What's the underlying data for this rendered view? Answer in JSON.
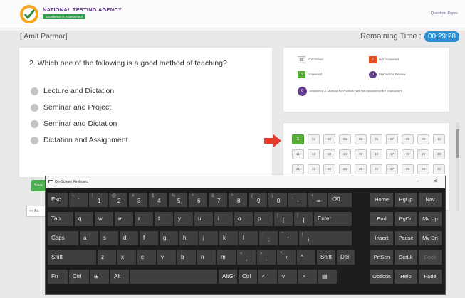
{
  "header": {
    "agency": "NATIONAL TESTING AGENCY",
    "tagline": "Excellence in Assessment",
    "question_paper_link": "Question Paper"
  },
  "exam": {
    "candidate": "[ Amit Parmar]",
    "remaining_label": "Remaining Time :",
    "timer": "00:29:28"
  },
  "question": {
    "text": "2. Which one of the following is a good method of teaching?",
    "options": [
      "Lecture and Dictation",
      "Seminar and Project",
      "Seminar and Dictation",
      "Dictation and Assignment."
    ]
  },
  "buttons": {
    "save_next": "Save",
    "prev": "<< Ba"
  },
  "legend": {
    "not_visited": {
      "count": "99",
      "label": "Not Visited"
    },
    "not_answered": {
      "count": "2",
      "label": "Not Answered"
    },
    "answered": {
      "count": "3",
      "label": "Answered"
    },
    "marked": {
      "count": "0",
      "label": "Marked for Review"
    },
    "answered_marked": {
      "count": "0",
      "label": "Answered & Marked for Review (will be considered for evaluation)"
    }
  },
  "palette": {
    "numbers": [
      "1",
      "02",
      "03",
      "04",
      "05",
      "06",
      "07",
      "08",
      "09",
      "10",
      "11",
      "12",
      "13",
      "14",
      "15",
      "16",
      "17",
      "18",
      "19",
      "20",
      "21",
      "22",
      "23",
      "24",
      "25",
      "26",
      "27",
      "28",
      "29",
      "30"
    ],
    "answered_index": 0
  },
  "keyboard": {
    "title": "On-Screen Keyboard",
    "minimize": "–",
    "close": "✕",
    "row1": [
      {
        "p": "Esc"
      },
      {
        "s": "~",
        "p": "`"
      },
      {
        "s": "!",
        "p": "1"
      },
      {
        "s": "@",
        "p": "2"
      },
      {
        "s": "#",
        "p": "3"
      },
      {
        "s": "$",
        "p": "4"
      },
      {
        "s": "%",
        "p": "5"
      },
      {
        "s": "^",
        "p": "6"
      },
      {
        "s": "&",
        "p": "7"
      },
      {
        "s": "*",
        "p": "8"
      },
      {
        "s": "(",
        "p": "9"
      },
      {
        "s": ")",
        "p": "0"
      },
      {
        "s": "_",
        "p": "-"
      },
      {
        "s": "+",
        "p": "="
      },
      {
        "p": "⌫"
      }
    ],
    "row2": [
      {
        "p": "Tab"
      },
      {
        "p": "q"
      },
      {
        "p": "w"
      },
      {
        "p": "e"
      },
      {
        "p": "r"
      },
      {
        "p": "t"
      },
      {
        "p": "y"
      },
      {
        "p": "u"
      },
      {
        "p": "i"
      },
      {
        "p": "o"
      },
      {
        "p": "p"
      },
      {
        "s": "{",
        "p": "["
      },
      {
        "s": "}",
        "p": "]"
      },
      {
        "p": "Enter"
      }
    ],
    "row3": [
      {
        "p": "Caps"
      },
      {
        "p": "a"
      },
      {
        "p": "s"
      },
      {
        "p": "d"
      },
      {
        "p": "f"
      },
      {
        "p": "g"
      },
      {
        "p": "h"
      },
      {
        "p": "j"
      },
      {
        "p": "k"
      },
      {
        "p": "l"
      },
      {
        "s": ":",
        "p": ";"
      },
      {
        "s": "\"",
        "p": "'"
      },
      {
        "s": "|",
        "p": "\\"
      }
    ],
    "row4": [
      {
        "p": "Shift"
      },
      {
        "p": "z"
      },
      {
        "p": "x"
      },
      {
        "p": "c"
      },
      {
        "p": "v"
      },
      {
        "p": "b"
      },
      {
        "p": "n"
      },
      {
        "p": "m"
      },
      {
        "s": "<",
        "p": ","
      },
      {
        "s": ">",
        "p": "."
      },
      {
        "s": "?",
        "p": "/"
      },
      {
        "p": "^"
      },
      {
        "p": "Shift"
      },
      {
        "p": "Del"
      }
    ],
    "row5": [
      {
        "p": "Fn"
      },
      {
        "p": "Ctrl"
      },
      {
        "p": "⊞"
      },
      {
        "p": "Alt"
      },
      {
        "p": ""
      },
      {
        "p": "AltGr"
      },
      {
        "p": "Ctrl"
      },
      {
        "p": "<"
      },
      {
        "p": "v"
      },
      {
        "p": ">"
      },
      {
        "p": "▤"
      }
    ],
    "nav": [
      [
        "Home",
        "PgUp",
        "Nav"
      ],
      [
        "End",
        "PgDn",
        "Mv Up"
      ],
      [
        "Insert",
        "Pause",
        "Mv Dn"
      ],
      [
        "PrtScn",
        "ScrLk",
        "Dock"
      ],
      [
        "Options",
        "Help",
        "Fade"
      ]
    ]
  }
}
